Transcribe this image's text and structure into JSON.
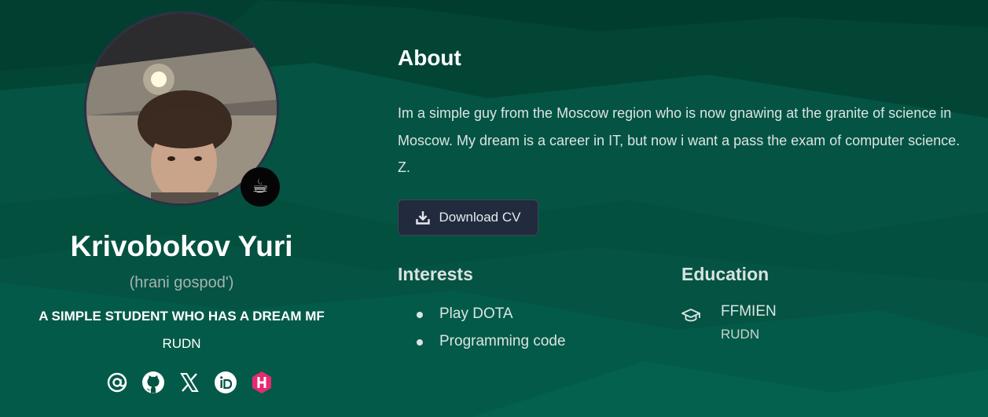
{
  "profile": {
    "name": "Krivobokov Yuri",
    "nickname": "(hrani gospod')",
    "tagline": "A SIMPLE STUDENT WHO HAS A DREAM MF",
    "affiliation": "RUDN",
    "status_emoji": "☕",
    "socials": [
      {
        "icon": "email-icon"
      },
      {
        "icon": "github-icon"
      },
      {
        "icon": "x-twitter-icon"
      },
      {
        "icon": "orcid-icon"
      },
      {
        "icon": "hashnode-icon"
      }
    ]
  },
  "about": {
    "title": "About",
    "text": "Im a simple guy from the Moscow region who is now gnawing at the granite of science in Moscow. My dream is a career in IT, but now i want a pass the exam of computer science. Z.",
    "download_label": "Download CV"
  },
  "interests": {
    "title": "Interests",
    "items": [
      "Play DOTA",
      "Programming code"
    ]
  },
  "education": {
    "title": "Education",
    "items": [
      {
        "degree": "FFMIEN",
        "institution": "RUDN"
      }
    ]
  },
  "colors": {
    "background": "#045343",
    "button": "#222a3d",
    "hashnode": "#e72a6f"
  }
}
